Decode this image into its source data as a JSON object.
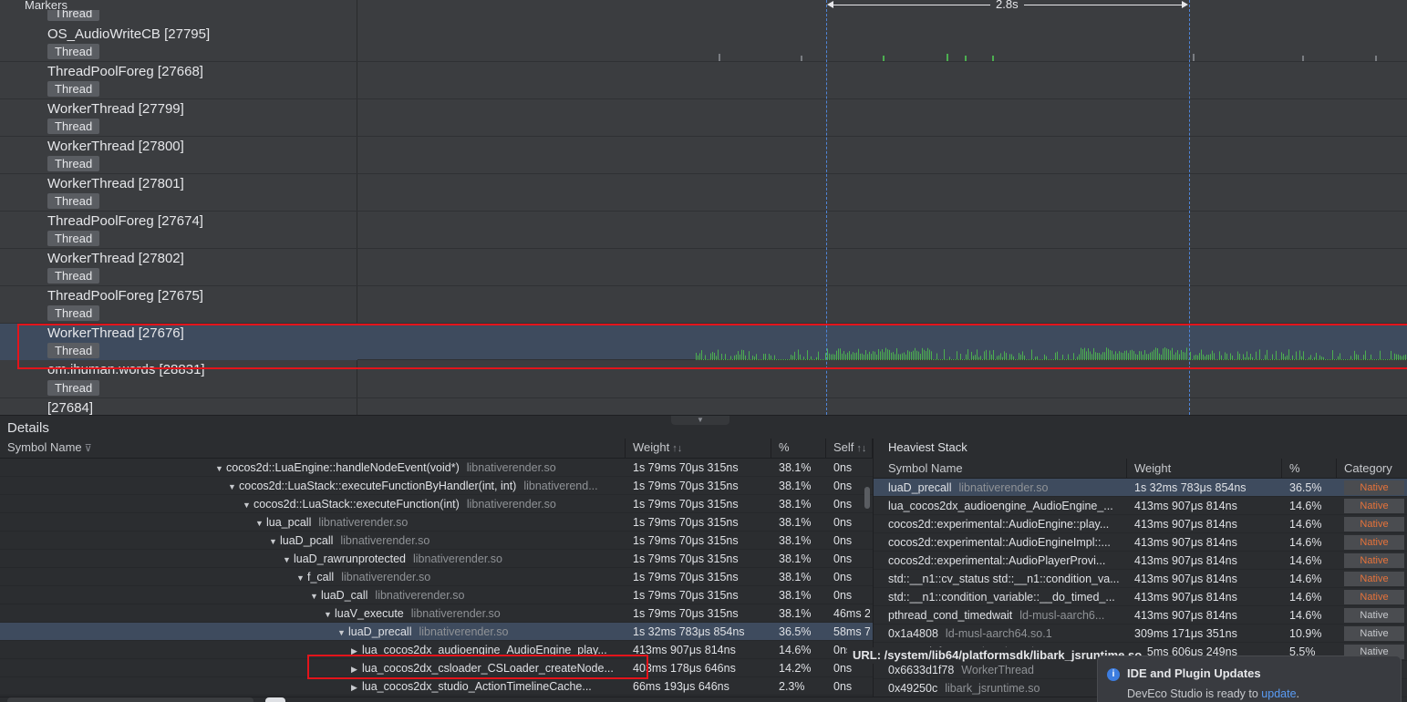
{
  "timeline": {
    "markers_label": "Markers",
    "top_partial_badge": "Thread",
    "span_label": "2.8s",
    "threads": [
      {
        "name": "OS_AudioWriteCB [27795]",
        "badge": "Thread"
      },
      {
        "name": "ThreadPoolForeg [27668]",
        "badge": "Thread"
      },
      {
        "name": "WorkerThread [27799]",
        "badge": "Thread"
      },
      {
        "name": "WorkerThread [27800]",
        "badge": "Thread"
      },
      {
        "name": "WorkerThread [27801]",
        "badge": "Thread"
      },
      {
        "name": "ThreadPoolForeg [27674]",
        "badge": "Thread"
      },
      {
        "name": "WorkerThread [27802]",
        "badge": "Thread"
      },
      {
        "name": "ThreadPoolForeg [27675]",
        "badge": "Thread"
      },
      {
        "name": "WorkerThread [27676]",
        "badge": "Thread"
      },
      {
        "name": "om.ihuman.words [28831]",
        "badge": "Thread"
      },
      {
        "name": "[27684]",
        "badge": ""
      }
    ]
  },
  "details": {
    "title": "Details",
    "columns": {
      "symbol": "Symbol Name",
      "weight": "Weight",
      "percent": "%",
      "self": "Self"
    },
    "rows": [
      {
        "caret": "▼",
        "symbol": "cocos2d::LuaEngine::handleNodeEvent(void*)",
        "lib": "libnativerender.so",
        "weight": "1s 79ms 70μs 315ns",
        "percent": "38.1%",
        "self": "0ns"
      },
      {
        "caret": "▼",
        "symbol": "cocos2d::LuaStack::executeFunctionByHandler(int, int)",
        "lib": "libnativerend...",
        "weight": "1s 79ms 70μs 315ns",
        "percent": "38.1%",
        "self": "0ns"
      },
      {
        "caret": "▼",
        "symbol": "cocos2d::LuaStack::executeFunction(int)",
        "lib": "libnativerender.so",
        "weight": "1s 79ms 70μs 315ns",
        "percent": "38.1%",
        "self": "0ns"
      },
      {
        "caret": "▼",
        "symbol": "lua_pcall",
        "lib": "libnativerender.so",
        "weight": "1s 79ms 70μs 315ns",
        "percent": "38.1%",
        "self": "0ns"
      },
      {
        "caret": "▼",
        "symbol": "luaD_pcall",
        "lib": "libnativerender.so",
        "weight": "1s 79ms 70μs 315ns",
        "percent": "38.1%",
        "self": "0ns"
      },
      {
        "caret": "▼",
        "symbol": "luaD_rawrunprotected",
        "lib": "libnativerender.so",
        "weight": "1s 79ms 70μs 315ns",
        "percent": "38.1%",
        "self": "0ns"
      },
      {
        "caret": "▼",
        "symbol": "f_call",
        "lib": "libnativerender.so",
        "weight": "1s 79ms 70μs 315ns",
        "percent": "38.1%",
        "self": "0ns"
      },
      {
        "caret": "▼",
        "symbol": "luaD_call",
        "lib": "libnativerender.so",
        "weight": "1s 79ms 70μs 315ns",
        "percent": "38.1%",
        "self": "0ns"
      },
      {
        "caret": "▼",
        "symbol": "luaV_execute",
        "lib": "libnativerender.so",
        "weight": "1s 79ms 70μs 315ns",
        "percent": "38.1%",
        "self": "46ms 2"
      },
      {
        "caret": "▼",
        "symbol": "luaD_precall",
        "lib": "libnativerender.so",
        "weight": "1s 32ms 783μs 854ns",
        "percent": "36.5%",
        "self": "58ms 7"
      },
      {
        "caret": "▶",
        "symbol": "lua_cocos2dx_audioengine_AudioEngine_play...",
        "lib": "",
        "weight": "413ms 907μs 814ns",
        "percent": "14.6%",
        "self": "0ns"
      },
      {
        "caret": "▶",
        "symbol": "lua_cocos2dx_csloader_CSLoader_createNode...",
        "lib": "",
        "weight": "403ms 178μs 646ns",
        "percent": "14.2%",
        "self": "0ns"
      },
      {
        "caret": "▶",
        "symbol": "lua_cocos2dx_studio_ActionTimelineCache...",
        "lib": "",
        "weight": "66ms 193μs 646ns",
        "percent": "2.3%",
        "self": "0ns"
      }
    ]
  },
  "heaviest": {
    "title": "Heaviest Stack",
    "columns": {
      "symbol": "Symbol Name",
      "weight": "Weight",
      "percent": "%",
      "category": "Category"
    },
    "rows": [
      {
        "symbol": "luaD_precall",
        "lib": "libnativerender.so",
        "weight": "1s 32ms 783μs 854ns",
        "percent": "36.5%",
        "category": "Native"
      },
      {
        "symbol": "lua_cocos2dx_audioengine_AudioEngine_...",
        "lib": "",
        "weight": "413ms 907μs 814ns",
        "percent": "14.6%",
        "category": "Native"
      },
      {
        "symbol": "cocos2d::experimental::AudioEngine::play...",
        "lib": "",
        "weight": "413ms 907μs 814ns",
        "percent": "14.6%",
        "category": "Native"
      },
      {
        "symbol": "cocos2d::experimental::AudioEngineImpl::...",
        "lib": "",
        "weight": "413ms 907μs 814ns",
        "percent": "14.6%",
        "category": "Native"
      },
      {
        "symbol": "cocos2d::experimental::AudioPlayerProvi...",
        "lib": "",
        "weight": "413ms 907μs 814ns",
        "percent": "14.6%",
        "category": "Native"
      },
      {
        "symbol": "std::__n1::cv_status std::__n1::condition_va...",
        "lib": "",
        "weight": "413ms 907μs 814ns",
        "percent": "14.6%",
        "category": "Native"
      },
      {
        "symbol": "std::__n1::condition_variable::__do_timed_...",
        "lib": "",
        "weight": "413ms 907μs 814ns",
        "percent": "14.6%",
        "category": "Native"
      },
      {
        "symbol": "pthread_cond_timedwait",
        "lib": "ld-musl-aarch6...",
        "weight": "413ms 907μs 814ns",
        "percent": "14.6%",
        "category": "Native"
      },
      {
        "symbol": "0x1a4808",
        "lib": "ld-musl-aarch64.so.1",
        "weight": "309ms 171μs 351ns",
        "percent": "10.9%",
        "category": "Native"
      },
      {
        "symbol": "0x6633d1f30",
        "lib": "WorkerThread",
        "weight": "155ms 606μs 249ns",
        "percent": "5.5%",
        "category": "Native"
      },
      {
        "symbol": "0x6633d1f78",
        "lib": "WorkerThread",
        "weight": "",
        "percent": "",
        "category": ""
      },
      {
        "symbol": "0x49250c",
        "lib": "libark_jsruntime.so",
        "weight": "",
        "percent": "",
        "category": ""
      }
    ]
  },
  "tooltip": "URL: /system/lib64/platformsdk/libark_jsruntime.so",
  "notification": {
    "title": "IDE and Plugin Updates",
    "body": "DevEco Studio is ready to ",
    "link": "update",
    "body_end": "."
  },
  "colors": {
    "selection": "#3e4b5e",
    "activity": "#4caf50",
    "highlight_box": "#e3141b",
    "native_text": "#e8733a"
  }
}
